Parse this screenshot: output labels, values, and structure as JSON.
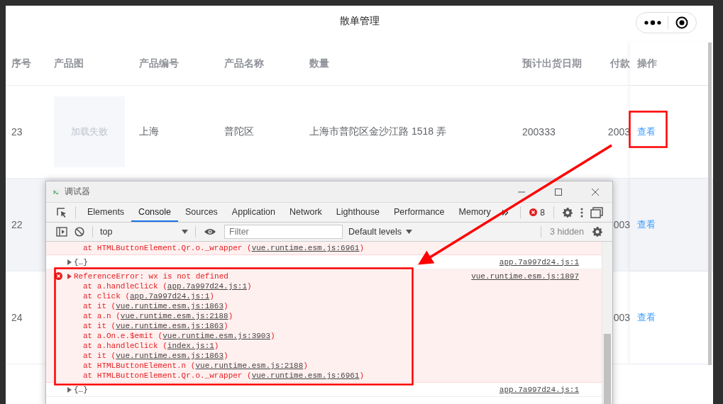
{
  "page": {
    "title": "散单管理"
  },
  "table": {
    "columns": [
      "序号",
      "产品图",
      "产品编号",
      "产品名称",
      "数量",
      "预计出货日期",
      "付款",
      "操作"
    ],
    "rows": [
      {
        "index": "23",
        "image_status": "加载失败",
        "code": "上海",
        "name": "普陀区",
        "quantity": "上海市普陀区金沙江路 1518 弄",
        "ship_date": "200333",
        "payment": "2003",
        "action": "查看",
        "highlighted": false
      },
      {
        "index": "22",
        "payment": "003",
        "action": "查看",
        "highlighted": true
      },
      {
        "index": "24",
        "payment": "003",
        "action": "查看",
        "highlighted": false
      }
    ]
  },
  "devtools": {
    "title": "调试器",
    "tabs": [
      {
        "label": "Elements",
        "selected": false
      },
      {
        "label": "Console",
        "selected": true
      },
      {
        "label": "Sources",
        "selected": false
      },
      {
        "label": "Application",
        "selected": false
      },
      {
        "label": "Network",
        "selected": false
      },
      {
        "label": "Lighthouse",
        "selected": false
      },
      {
        "label": "Performance",
        "selected": false
      },
      {
        "label": "Memory",
        "selected": false
      }
    ],
    "error_count": "8",
    "context": "top",
    "filter": {
      "placeholder": "Filter"
    },
    "levels": "Default levels",
    "hidden_count": "3 hidden",
    "messages": [
      {
        "kind": "trace",
        "lines": [
          {
            "before": "at HTMLButtonElement.Qr.o._wrapper (",
            "link": "vue.runtime.esm.js:6961",
            "after": ")"
          }
        ]
      },
      {
        "kind": "object",
        "text": "{…}",
        "source": "app.7a997d24.js:1"
      },
      {
        "kind": "error",
        "text": "ReferenceError: wx is not defined",
        "source": "vue.runtime.esm.js:1897",
        "lines": [
          {
            "before": "at a.handleClick (",
            "link": "app.7a997d24.js:1",
            "after": ")"
          },
          {
            "before": "at click (",
            "link": "app.7a997d24.js:1",
            "after": ")"
          },
          {
            "before": "at it (",
            "link": "vue.runtime.esm.js:1863",
            "after": ")"
          },
          {
            "before": "at a.n (",
            "link": "vue.runtime.esm.js:2188",
            "after": ")"
          },
          {
            "before": "at it (",
            "link": "vue.runtime.esm.js:1863",
            "after": ")"
          },
          {
            "before": "at a.On.e.$emit (",
            "link": "vue.runtime.esm.js:3903",
            "after": ")"
          },
          {
            "before": "at a.handleClick (",
            "link": "index.js:1",
            "after": ")"
          },
          {
            "before": "at it (",
            "link": "vue.runtime.esm.js:1863",
            "after": ")"
          },
          {
            "before": "at HTMLButtonElement.n (",
            "link": "vue.runtime.esm.js:2188",
            "after": ")"
          },
          {
            "before": "at HTMLButtonElement.Qr.o._wrapper (",
            "link": "vue.runtime.esm.js:6961",
            "after": ")"
          }
        ]
      },
      {
        "kind": "object",
        "text": "{…}",
        "source": "app.7a997d24.js:1"
      }
    ]
  }
}
